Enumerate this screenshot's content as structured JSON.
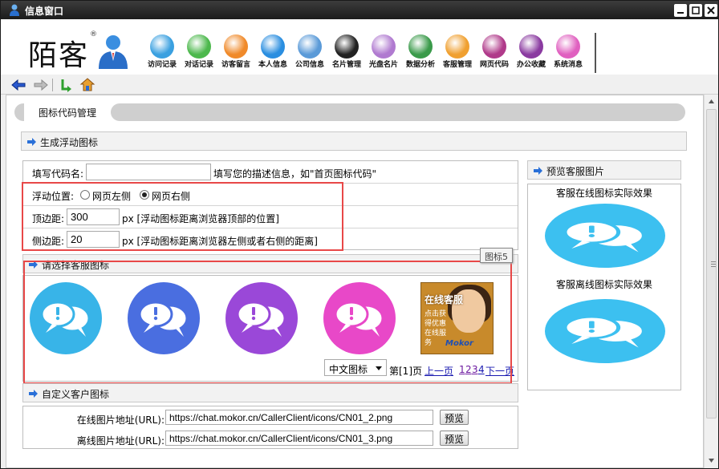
{
  "window": {
    "title": "信息窗口"
  },
  "brand": {
    "logo_text": "陌客",
    "logo_mark": "®"
  },
  "nav": [
    {
      "label": "访问记录",
      "color": "#3aa0e0",
      "icon": "user-icon"
    },
    {
      "label": "对话记录",
      "color": "#4cb84c",
      "icon": "chat-record-icon"
    },
    {
      "label": "访客留言",
      "color": "#f08a2a",
      "icon": "envelope-icon"
    },
    {
      "label": "本人信息",
      "color": "#2a8ee0",
      "icon": "person-icon"
    },
    {
      "label": "公司信息",
      "color": "#5a9ad8",
      "icon": "building-icon"
    },
    {
      "label": "名片管理",
      "color": "#222222",
      "icon": "card-icon"
    },
    {
      "label": "光盘名片",
      "color": "#b07ad0",
      "icon": "disc-icon"
    },
    {
      "label": "数据分析",
      "color": "#3a9a4a",
      "icon": "bar-chart-icon"
    },
    {
      "label": "客服管理",
      "color": "#f0a030",
      "icon": "team-icon"
    },
    {
      "label": "网页代码",
      "color": "#b03a8a",
      "icon": "link-icon"
    },
    {
      "label": "办公收藏",
      "color": "#8a3aa0",
      "icon": "box-icon"
    },
    {
      "label": "系统消息",
      "color": "#e060c0",
      "icon": "bell-icon"
    }
  ],
  "page": {
    "tab_title": "图标代码管理",
    "section_generate": "生成浮动图标",
    "form": {
      "code_name_label": "填写代码名:",
      "code_name_value": "",
      "code_name_hint": "填写您的描述信息，如\"首页图标代码\"",
      "position_label": "浮动位置:",
      "position_left": "网页左侧",
      "position_right": "网页右侧",
      "top_label": "顶边距:",
      "top_value": "300",
      "top_hint": "px [浮动图标距离浏览器顶部的位置]",
      "side_label": "侧边距:",
      "side_value": "20",
      "side_hint": "px [浮动图标距离浏览器左侧或者右侧的距离]"
    },
    "section_choose": "请选择客服图标",
    "tooltip": "图标5",
    "icons": [
      {
        "name": "icon-option-1",
        "color": "#38b4e8"
      },
      {
        "name": "icon-option-2",
        "color": "#4a6ee0"
      },
      {
        "name": "icon-option-3",
        "color": "#9a48d8"
      },
      {
        "name": "icon-option-4",
        "color": "#e848c8"
      }
    ],
    "photo_icon": {
      "title": "在线客服",
      "sub": "点击获得优惠在线服务",
      "brand": "Mokor"
    },
    "lang_select": "中文图标",
    "pager": {
      "page_text": "第[1]页",
      "prev": "上一页",
      "pages": [
        "1",
        "2",
        "3",
        "4"
      ],
      "next": "下一页"
    },
    "section_custom": "自定义客户图标",
    "online_url_label": "在线图片地址(URL):",
    "online_url_value": "https://chat.mokor.cn/CallerClient/icons/CN01_2.png",
    "offline_url_label": "离线图片地址(URL):",
    "offline_url_value": "https://chat.mokor.cn/CallerClient/icons/CN01_3.png",
    "preview_button": "预览",
    "section_preview": "预览客服图片",
    "preview_online_title": "客服在线图标实际效果",
    "preview_offline_title": "客服离线图标实际效果",
    "preview_color": "#3cc0f0"
  }
}
